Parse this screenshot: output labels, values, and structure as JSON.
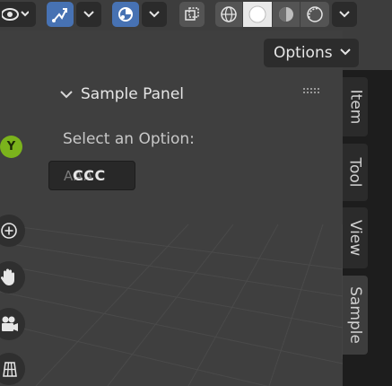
{
  "options": {
    "label": "Options"
  },
  "panel": {
    "title": "Sample Panel",
    "select_label": "Select an Option:",
    "enum_value": "CCC",
    "enum_ghost": "AAA"
  },
  "gizmo": {
    "axis_label": "Y"
  },
  "sidebar": {
    "tabs": [
      {
        "label": "Item"
      },
      {
        "label": "Tool"
      },
      {
        "label": "View"
      },
      {
        "label": "Sample"
      }
    ]
  },
  "colors": {
    "accent": "#4772b3",
    "axis_y": "#7bb31c",
    "panel_bg": "#303030"
  }
}
